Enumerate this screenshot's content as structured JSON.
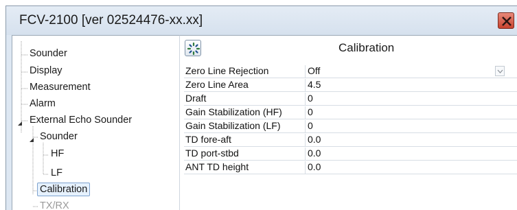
{
  "window": {
    "title": "FCV-2100 [ver 02524476-xx.xx]"
  },
  "tree": {
    "items": [
      {
        "label": "Sounder"
      },
      {
        "label": "Display"
      },
      {
        "label": "Measurement"
      },
      {
        "label": "Alarm"
      },
      {
        "label": "External Echo Sounder"
      },
      {
        "label": "Sounder"
      },
      {
        "label": "HF"
      },
      {
        "label": "LF"
      },
      {
        "label": "Calibration",
        "selected": true
      },
      {
        "label": "TX/RX",
        "disabled": true
      }
    ]
  },
  "pane": {
    "title": "Calibration",
    "settings_icon": "gear-icon",
    "rows": [
      {
        "label": "Zero Line Rejection",
        "value": "Off"
      },
      {
        "label": "Zero Line Area",
        "value": "4.5"
      },
      {
        "label": "Draft",
        "value": "0"
      },
      {
        "label": "Gain Stabilization (HF)",
        "value": "0"
      },
      {
        "label": "Gain Stabilization (LF)",
        "value": "0"
      },
      {
        "label": "TD fore-aft",
        "value": "0.0"
      },
      {
        "label": "TD port-stbd",
        "value": "0.0"
      },
      {
        "label": "ANT TD height",
        "value": "0.0"
      }
    ]
  },
  "colors": {
    "window_bg": "#dde7f2",
    "close_button": "#c8432f",
    "selection_border": "#7da2ce"
  }
}
